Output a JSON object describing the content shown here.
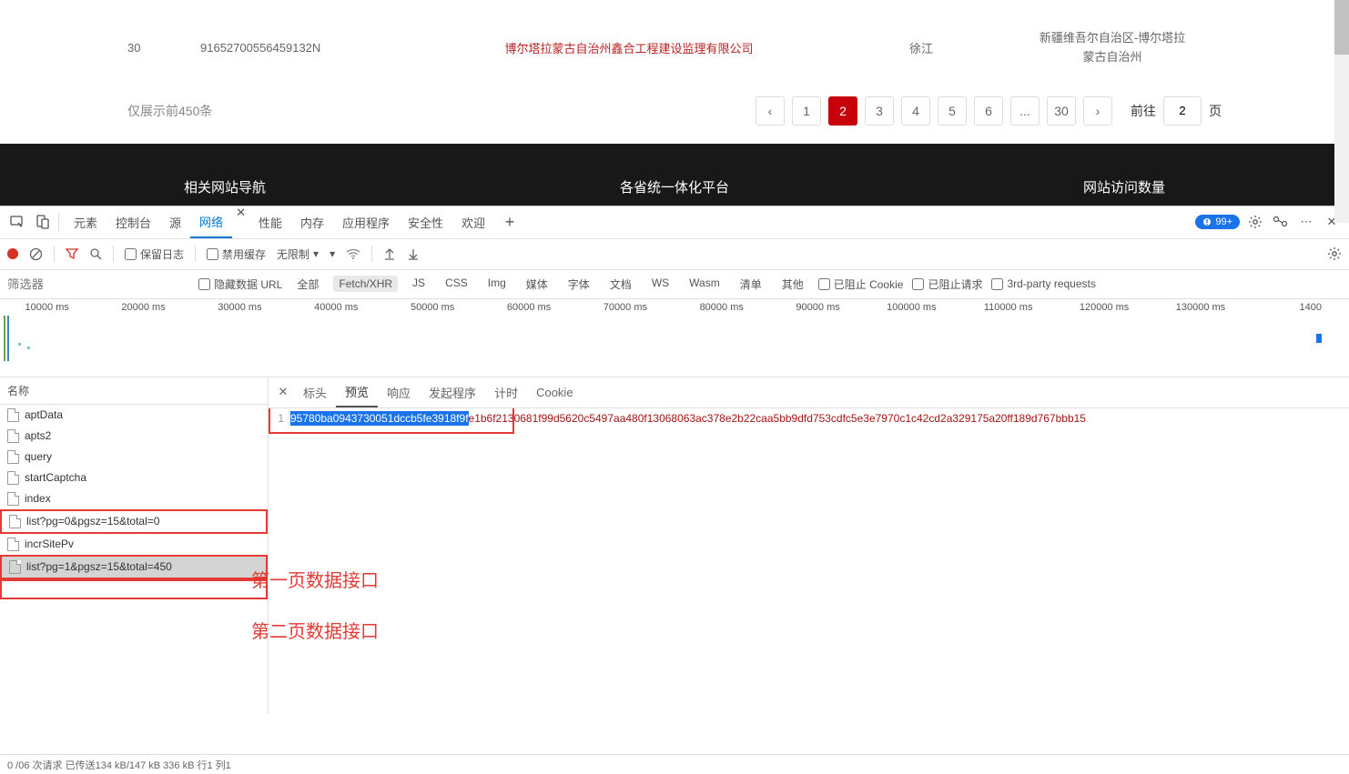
{
  "table": {
    "row": {
      "num": "30",
      "id": "91652700556459132N",
      "company": "博尔塔拉蒙古自治州鑫合工程建设监理有限公司",
      "person": "徐江",
      "region_line1": "新疆维吾尔自治区-博尔塔拉",
      "region_line2": "蒙古自治州"
    }
  },
  "pagination": {
    "note": "仅展示前450条",
    "pages": [
      "1",
      "2",
      "3",
      "4",
      "5",
      "6",
      "...",
      "30"
    ],
    "active": "2",
    "goto_label": "前往",
    "goto_value": "2",
    "goto_suffix": "页"
  },
  "dark_nav": {
    "a": "相关网站导航",
    "b": "各省统一体化平台",
    "c": "网站访问数量"
  },
  "devtools": {
    "tabs": [
      "元素",
      "控制台",
      "源",
      "网络",
      "性能",
      "内存",
      "应用程序",
      "安全性",
      "欢迎"
    ],
    "active_tab": "网络",
    "issues_count": "99+",
    "toolbar": {
      "preserve_log": "保留日志",
      "disable_cache": "禁用缓存",
      "throttle": "无限制"
    },
    "filter_placeholder": "筛选器",
    "filters": {
      "hide_data": "隐藏数据 URL",
      "all": "全部",
      "fetch": "Fetch/XHR",
      "items": [
        "JS",
        "CSS",
        "Img",
        "媒体",
        "字体",
        "文档",
        "WS",
        "Wasm",
        "清单",
        "其他"
      ],
      "blocked_cookie": "已阻止 Cookie",
      "blocked_req": "已阻止请求",
      "third_party": "3rd-party requests"
    },
    "timeline_labels": [
      "10000 ms",
      "20000 ms",
      "30000 ms",
      "40000 ms",
      "50000 ms",
      "60000 ms",
      "70000 ms",
      "80000 ms",
      "90000 ms",
      "100000 ms",
      "110000 ms",
      "120000 ms",
      "130000 ms",
      "1400"
    ],
    "requests_header": "名称",
    "requests": [
      {
        "name": "aptData"
      },
      {
        "name": "apts2"
      },
      {
        "name": "query"
      },
      {
        "name": "startCaptcha"
      },
      {
        "name": "index"
      },
      {
        "name": "list?pg=0&pgsz=15&total=0",
        "boxed": true
      },
      {
        "name": "incrSitePv"
      },
      {
        "name": "list?pg=1&pgsz=15&total=450",
        "selected": true,
        "boxed": true
      }
    ],
    "detail_tabs": [
      "标头",
      "预览",
      "响应",
      "发起程序",
      "计时",
      "Cookie"
    ],
    "detail_active": "预览",
    "preview": {
      "line_no": "1",
      "highlighted": "95780ba0943730051dccb5fe3918f9f",
      "rest": "e1b6f2130681f99d5620c5497aa480f13068063ac378e2b22caa5bb9dfd753cdfc5e3e7970c1c42cd2a329175a20ff189d767bbb15"
    },
    "annotations": {
      "a": "第一页数据接口",
      "b": "第二页数据接口"
    },
    "status": "0 /06 次请求  已传送134 kB/147 kB  336 kB  行1  列1"
  }
}
